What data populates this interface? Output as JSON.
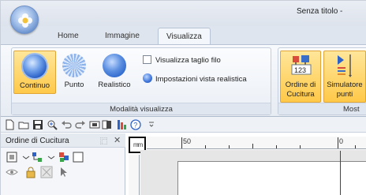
{
  "window": {
    "title": "Senza titolo -"
  },
  "tabs": [
    {
      "label": "Home",
      "active": false
    },
    {
      "label": "Immagine",
      "active": false
    },
    {
      "label": "Visualizza",
      "active": true
    }
  ],
  "ribbon": {
    "group_view_mode": {
      "label": "Modalità visualizza",
      "buttons": [
        {
          "label": "Continuo",
          "selected": true,
          "icon": "continuous-view-icon"
        },
        {
          "label": "Punto",
          "selected": false,
          "icon": "stitch-point-icon"
        },
        {
          "label": "Realistico",
          "selected": false,
          "icon": "realistic-view-icon"
        }
      ],
      "checkbox_thread": {
        "label": "Visualizza taglio filo",
        "checked": false
      },
      "realistic_settings": {
        "label": "Impostazioni vista realistica"
      }
    },
    "group_show": {
      "label": "Most",
      "buttons": [
        {
          "label_line1": "Ordine di",
          "label_line2": "Cucitura",
          "selected": true,
          "badge": "123",
          "icon": "sewing-order-icon"
        },
        {
          "label_line1": "Simulatore",
          "label_line2": "punti",
          "selected": true,
          "icon": "stitch-simulator-icon"
        }
      ]
    }
  },
  "quick_access": [
    "new-icon",
    "open-icon",
    "save-icon",
    "zoom-icon",
    "undo-icon",
    "redo-icon",
    "layout-icon",
    "page-icon",
    "color-icon",
    "help-icon",
    "dropdown-icon"
  ],
  "panel": {
    "title": "Ordine di Cucitura",
    "pin": "⿸",
    "close": "✕"
  },
  "ruler": {
    "corner": "mm",
    "labels": [
      "50",
      "0"
    ]
  },
  "colors": {
    "accent": "#ffc949",
    "ribbon_bg": "#eaeff6",
    "blue_orb": "#1c54c1"
  }
}
